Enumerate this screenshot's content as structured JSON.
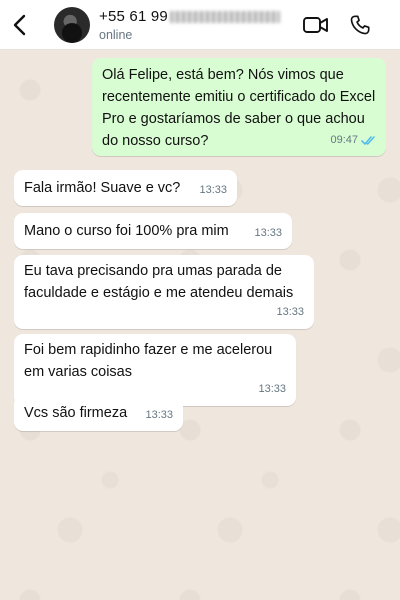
{
  "header": {
    "contact_name": "+55 61 99",
    "contact_status": "online"
  },
  "icons": {
    "back": "chevron-left-icon",
    "video": "video-camera-icon",
    "call": "phone-icon",
    "read_receipt": "double-check-icon"
  },
  "colors": {
    "outgoing_bubble": "#d9fdd3",
    "incoming_bubble": "#ffffff",
    "chat_background": "#efe7de",
    "read_ticks": "#53bdeb"
  },
  "messages": [
    {
      "direction": "outgoing",
      "text": "Olá Felipe, está bem? Nós vimos que recentemente emitiu o certificado do Excel Pro e gostaríamos de saber o que achou do nosso curso?",
      "time": "09:47",
      "status": "read"
    },
    {
      "direction": "incoming",
      "text": "Fala irmão! Suave e vc?",
      "time": "13:33"
    },
    {
      "direction": "incoming",
      "text": "Mano o curso foi 100% pra mim",
      "time": "13:33"
    },
    {
      "direction": "incoming",
      "text": "Eu tava precisando pra umas parada de faculdade e estágio e me atendeu demais",
      "time": "13:33"
    },
    {
      "direction": "incoming",
      "text": "Foi bem rapidinho fazer e me acelerou em varias coisas",
      "time": "13:33"
    },
    {
      "direction": "incoming",
      "text": "Vcs são firmeza",
      "time": "13:33"
    }
  ]
}
